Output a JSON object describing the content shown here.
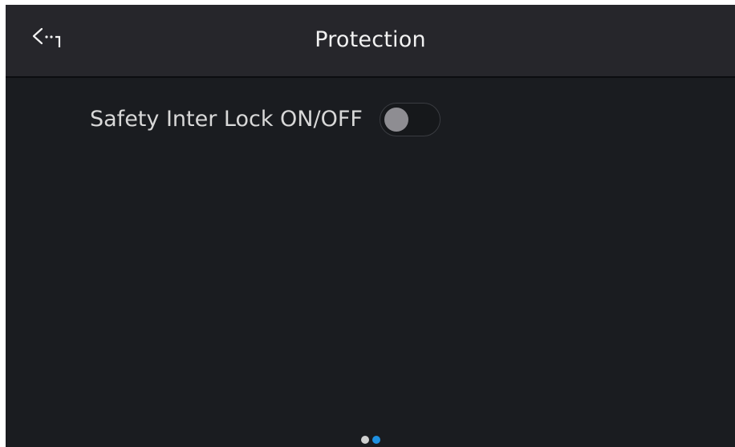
{
  "header": {
    "title": "Protection",
    "back_icon": "back-arrow-icon"
  },
  "settings": {
    "safety_interlock": {
      "label": "Safety Inter Lock ON/OFF",
      "state": "off"
    }
  },
  "pagination": {
    "total": 2,
    "current": 2
  },
  "colors": {
    "background": "#1a1c20",
    "header_background": "#26262b",
    "accent": "#1e90e0",
    "inactive_dot": "#d0d0d0",
    "toggle_knob_off": "#8e8d92"
  }
}
